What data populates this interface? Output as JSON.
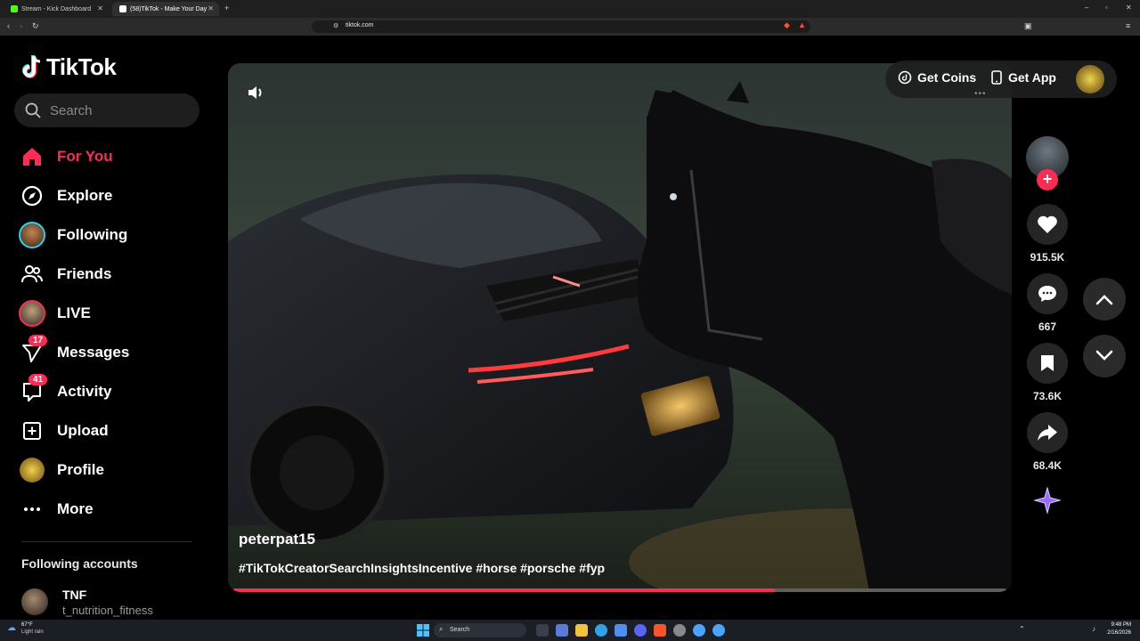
{
  "browser": {
    "tabs": [
      {
        "title": "Stream - Kick Dashboard",
        "active": false
      },
      {
        "title": "(58)TikTok - Make Your Day",
        "active": true
      }
    ],
    "url": "tiktok.com"
  },
  "sidebar": {
    "logo": "TikTok",
    "search_placeholder": "Search",
    "nav": [
      {
        "label": "For You",
        "icon": "home-icon",
        "active": true
      },
      {
        "label": "Explore",
        "icon": "compass-icon"
      },
      {
        "label": "Following",
        "icon": "avatar-icon"
      },
      {
        "label": "Friends",
        "icon": "friends-icon"
      },
      {
        "label": "LIVE",
        "icon": "live-avatar-icon"
      },
      {
        "label": "Messages",
        "icon": "paper-plane-icon",
        "badge": "17"
      },
      {
        "label": "Activity",
        "icon": "inbox-icon",
        "badge": "41"
      },
      {
        "label": "Upload",
        "icon": "plus-square-icon"
      },
      {
        "label": "Profile",
        "icon": "profile-avatar-icon"
      },
      {
        "label": "More",
        "icon": "more-dots-icon"
      }
    ],
    "following_title": "Following accounts",
    "following_accounts": [
      {
        "name": "TNF",
        "handle": "t_nutrition_fitness"
      }
    ]
  },
  "video": {
    "creator": "peterpat15",
    "caption": "#TikTokCreatorSearchInsightsIncentive #horse #porsche #fyp",
    "progress": 0.7
  },
  "top_actions": {
    "get_coins": "Get Coins",
    "get_app": "Get App"
  },
  "actions": {
    "likes": "915.5K",
    "comments": "667",
    "saves": "73.6K",
    "shares": "68.4K"
  },
  "taskbar": {
    "weather_temp": "67°F",
    "weather_desc": "Light rain",
    "search_label": "Search",
    "time": "9:48 PM",
    "date": "2/16/2026"
  },
  "colors": {
    "accent": "#fe2c55",
    "background": "#000000"
  }
}
